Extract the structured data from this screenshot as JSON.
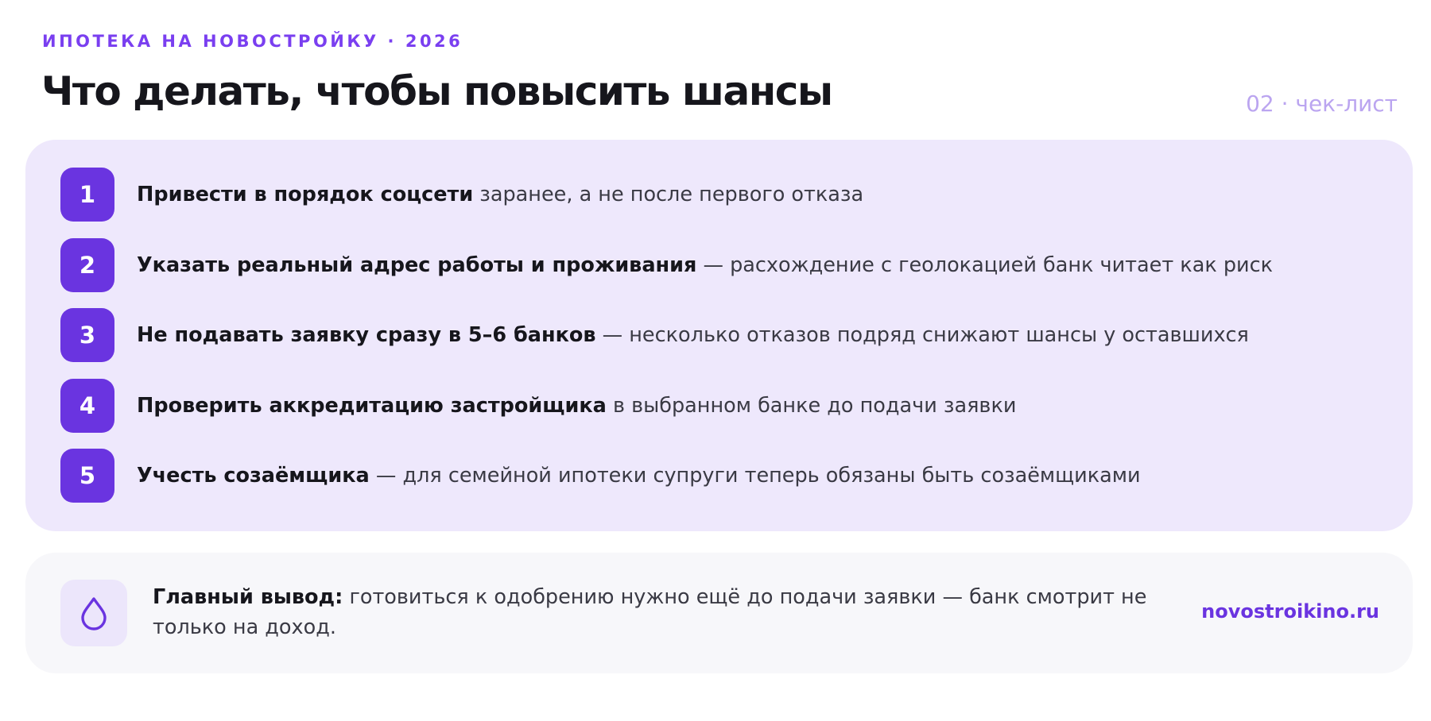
{
  "header": {
    "eyebrow": "ИПОТЕКА НА НОВОСТРОЙКУ · 2026",
    "title": "Что делать, чтобы повысить шансы",
    "counter": "02 · чек-лист"
  },
  "checklist": [
    {
      "num": "1",
      "bold": "Привести в порядок соцсети",
      "rest": " заранее, а не после первого отказа"
    },
    {
      "num": "2",
      "bold": "Указать реальный адрес работы и проживания",
      "rest": " — расхождение с геолокацией банк читает как риск"
    },
    {
      "num": "3",
      "bold": "Не подавать заявку сразу в 5–6 банков",
      "rest": " — несколько отказов подряд снижают шансы у оставшихся"
    },
    {
      "num": "4",
      "bold": "Проверить аккредитацию застройщика",
      "rest": " в выбранном банке до подачи заявки"
    },
    {
      "num": "5",
      "bold": "Учесть созаёмщика",
      "rest": " — для семейной ипотеки супруги теперь обязаны быть созаёмщиками"
    }
  ],
  "summary": {
    "icon": "drop-icon",
    "bold": "Главный вывод:",
    "rest": " готовиться к одобрению нужно ещё до подачи заявки — банк смотрит не только на доход.",
    "link": "novostroikino.ru"
  },
  "colors": {
    "accent": "#6a34e0",
    "eyebrow": "#7a3ff0",
    "card_bg": "#eee8fc",
    "summary_bg": "#f7f7fa",
    "counter": "#bba5f0"
  }
}
